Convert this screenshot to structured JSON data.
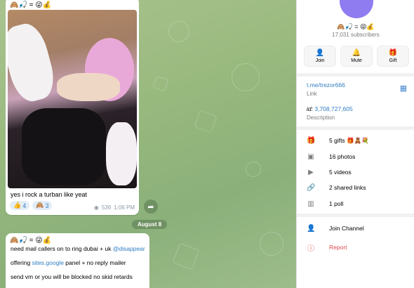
{
  "chat": {
    "message1": {
      "sender": "🙈🎣 = 😜💰",
      "caption": "yes i rock a turban like yeat",
      "reactions": [
        {
          "emoji": "👍",
          "count": "4"
        },
        {
          "emoji": "🙈",
          "count": "3"
        }
      ],
      "views": "536",
      "time": "1:06 PM"
    },
    "forward_icon": "forward-arrow-icon",
    "date_separator": "August 8",
    "message2": {
      "sender": "🙈🎣 = 😜💰",
      "line1_text": "need mail callers on to ring dubai + uk ",
      "line1_mention": "@disappear",
      "line2_prefix": "offering ",
      "line2_link": "sites.google",
      "line2_suffix": " panel + no reply mailer",
      "line3_text": "send vm or you will be blocked no skid retards"
    }
  },
  "panel": {
    "title": "🙈🎣 = 😜💰",
    "subscribers": "17,031 subscribers",
    "actions": [
      {
        "icon": "person-add-icon",
        "glyph": "👤",
        "label": "Join"
      },
      {
        "icon": "bell-icon",
        "glyph": "🔔",
        "label": "Mute"
      },
      {
        "icon": "gift-icon",
        "glyph": "🎁",
        "label": "Gift"
      }
    ],
    "link": {
      "value": "t.me/trezor666",
      "label": "Link"
    },
    "id": {
      "prefix": "id:",
      "value": "3,708,727,605"
    },
    "description_label": "Description",
    "media_rows": [
      {
        "icon": "gift-icon",
        "glyph": "🎁",
        "text": "5 gifts 🎁🧸💐"
      },
      {
        "icon": "photo-icon",
        "glyph": "▣",
        "text": "16 photos"
      },
      {
        "icon": "video-icon",
        "glyph": "▶",
        "text": "5 videos"
      },
      {
        "icon": "link-icon",
        "glyph": "🔗",
        "text": "2 shared links"
      },
      {
        "icon": "poll-icon",
        "glyph": "▥",
        "text": "1 poll"
      }
    ],
    "join_channel": "Join Channel",
    "report": "Report"
  },
  "colors": {
    "accent": "#2f7dc2",
    "avatar": "#8f7cf0",
    "danger": "#e04b4b"
  }
}
